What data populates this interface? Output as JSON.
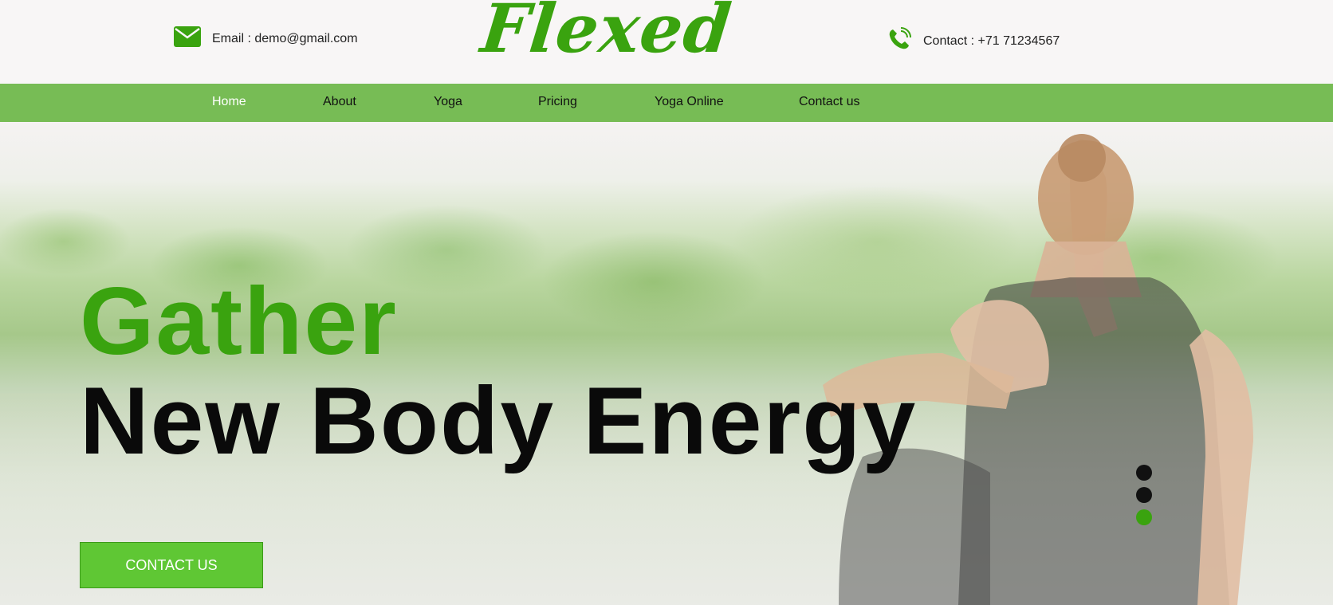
{
  "header": {
    "email_text": "Email : demo@gmail.com",
    "logo_text": "Flexed",
    "phone_text": "Contact : +71 71234567",
    "icons": {
      "email": "envelope-icon",
      "phone": "phone-icon"
    }
  },
  "nav": {
    "items": [
      {
        "label": "Home",
        "active": true
      },
      {
        "label": "About",
        "active": false
      },
      {
        "label": "Yoga",
        "active": false
      },
      {
        "label": "Pricing",
        "active": false
      },
      {
        "label": "Yoga Online",
        "active": false
      },
      {
        "label": "Contact us",
        "active": false
      }
    ]
  },
  "hero": {
    "headline_line1": "Gather",
    "headline_line2": "New Body Energy",
    "cta_label": "CONTACT US",
    "slider": {
      "count": 3,
      "active_index": 2
    }
  },
  "colors": {
    "brand_green": "#3aa30f",
    "nav_bg": "#77bc55",
    "button_bg": "#5fc734",
    "text_dark": "#0a0a0a"
  }
}
